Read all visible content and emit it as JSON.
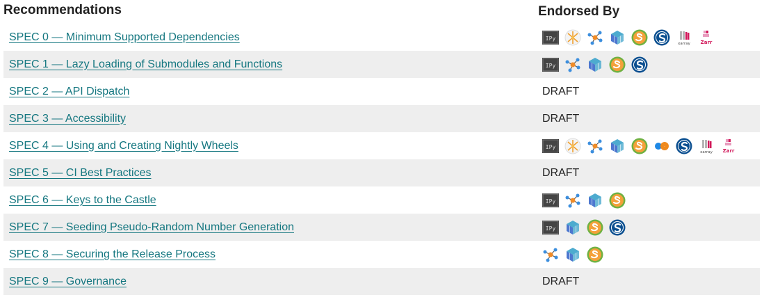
{
  "headers": {
    "recommendations": "Recommendations",
    "endorsed_by": "Endorsed By"
  },
  "rows": [
    {
      "title": "SPEC 0 — Minimum Supported Dependencies",
      "status": "",
      "endorsers": [
        "ipython-icon",
        "xarray-star-icon",
        "networkx-icon",
        "numpy-icon",
        "scikit-image-icon",
        "scipy-icon",
        "xarray-icon",
        "zarr-icon"
      ]
    },
    {
      "title": "SPEC 1 — Lazy Loading of Submodules and Functions",
      "status": "",
      "endorsers": [
        "ipython-icon",
        "networkx-icon",
        "numpy-icon",
        "scikit-image-icon",
        "scipy-icon"
      ]
    },
    {
      "title": "SPEC 2 — API Dispatch",
      "status": "DRAFT",
      "endorsers": []
    },
    {
      "title": "SPEC 3 — Accessibility",
      "status": "DRAFT",
      "endorsers": []
    },
    {
      "title": "SPEC 4 — Using and Creating Nightly Wheels",
      "status": "",
      "endorsers": [
        "ipython-icon",
        "xarray-star-icon",
        "networkx-icon",
        "numpy-icon",
        "scikit-image-icon",
        "scipy-icon",
        "xarray-icon",
        "zarr-icon"
      ]
    },
    {
      "title": "SPEC 5 — CI Best Practices",
      "status": "DRAFT",
      "endorsers": []
    },
    {
      "title": "SPEC 6 — Keys to the Castle",
      "status": "",
      "endorsers": [
        "ipython-icon",
        "networkx-icon",
        "numpy-icon",
        "scikit-image-icon"
      ]
    },
    {
      "title": "SPEC 7 — Seeding Pseudo-Random Number Generation",
      "status": "",
      "endorsers": [
        "ipython-icon",
        "numpy-icon",
        "scikit-image-icon",
        "scipy-icon"
      ]
    },
    {
      "title": "SPEC 8 — Securing the Release Process",
      "status": "",
      "endorsers": [
        "networkx-icon",
        "numpy-icon",
        "scikit-image-icon"
      ]
    },
    {
      "title": "SPEC 9 — Governance",
      "status": "DRAFT",
      "endorsers": []
    }
  ],
  "icon_labels": {
    "ipython": "IPy",
    "xarray": "xarray",
    "zarr": "Zarr",
    "scipy": "S"
  },
  "colors": {
    "link": "#157780",
    "row_stripe": "#eeeeee"
  }
}
